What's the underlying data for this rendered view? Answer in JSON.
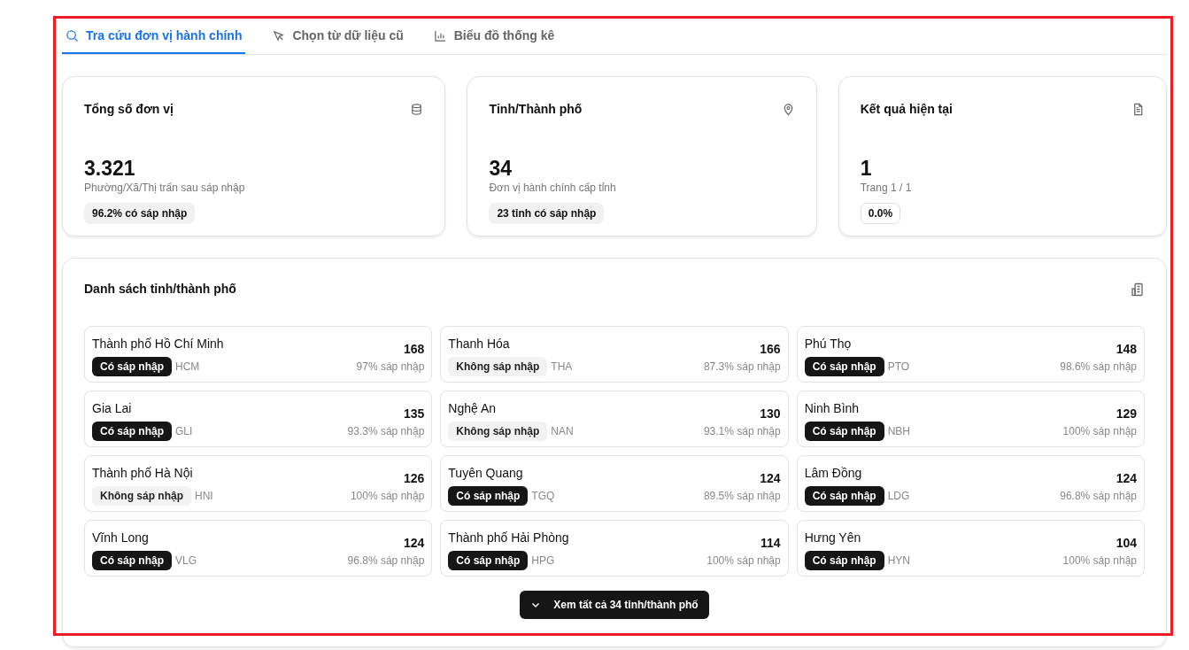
{
  "tabs": [
    {
      "label": "Tra cứu đơn vị hành chính",
      "selected": true
    },
    {
      "label": "Chọn từ dữ liệu cũ",
      "selected": false
    },
    {
      "label": "Biểu đồ thống kê",
      "selected": false
    }
  ],
  "stats": [
    {
      "title": "Tổng số đơn vị",
      "value": "3.321",
      "subtitle": "Phường/Xã/Thị trấn sau sáp nhập",
      "badge": "96.2% có sáp nhập",
      "outlined": false
    },
    {
      "title": "Tỉnh/Thành phố",
      "value": "34",
      "subtitle": "Đơn vị hành chính cấp tỉnh",
      "badge": "23 tỉnh có sáp nhập",
      "outlined": false
    },
    {
      "title": "Kết quả hiện tại",
      "value": "1",
      "subtitle": "Trang 1 / 1",
      "badge": "0.0%",
      "outlined": true
    }
  ],
  "province_list": {
    "title": "Danh sách tỉnh/thành phố",
    "items": [
      {
        "name": "Thành phố Hồ Chí Minh",
        "merged": true,
        "status": "Có sáp nhập",
        "code": "HCM",
        "count": "168",
        "rate": "97% sáp nhập"
      },
      {
        "name": "Thanh Hóa",
        "merged": false,
        "status": "Không sáp nhập",
        "code": "THA",
        "count": "166",
        "rate": "87.3% sáp nhập"
      },
      {
        "name": "Phú Thọ",
        "merged": true,
        "status": "Có sáp nhập",
        "code": "PTO",
        "count": "148",
        "rate": "98.6% sáp nhập"
      },
      {
        "name": "Gia Lai",
        "merged": true,
        "status": "Có sáp nhập",
        "code": "GLI",
        "count": "135",
        "rate": "93.3% sáp nhập"
      },
      {
        "name": "Nghệ An",
        "merged": false,
        "status": "Không sáp nhập",
        "code": "NAN",
        "count": "130",
        "rate": "93.1% sáp nhập"
      },
      {
        "name": "Ninh Bình",
        "merged": true,
        "status": "Có sáp nhập",
        "code": "NBH",
        "count": "129",
        "rate": "100% sáp nhập"
      },
      {
        "name": "Thành phố Hà Nội",
        "merged": false,
        "status": "Không sáp nhập",
        "code": "HNI",
        "count": "126",
        "rate": "100% sáp nhập"
      },
      {
        "name": "Tuyên Quang",
        "merged": true,
        "status": "Có sáp nhập",
        "code": "TGQ",
        "count": "124",
        "rate": "89.5% sáp nhập"
      },
      {
        "name": "Lâm Đồng",
        "merged": true,
        "status": "Có sáp nhập",
        "code": "LDG",
        "count": "124",
        "rate": "96.8% sáp nhập"
      },
      {
        "name": "Vĩnh Long",
        "merged": true,
        "status": "Có sáp nhập",
        "code": "VLG",
        "count": "124",
        "rate": "96.8% sáp nhập"
      },
      {
        "name": "Thành phố Hải Phòng",
        "merged": true,
        "status": "Có sáp nhập",
        "code": "HPG",
        "count": "114",
        "rate": "100% sáp nhập"
      },
      {
        "name": "Hưng Yên",
        "merged": true,
        "status": "Có sáp nhập",
        "code": "HYN",
        "count": "104",
        "rate": "100% sáp nhập"
      }
    ],
    "show_all_button": "Xem tất cả 34 tỉnh/thành phố"
  }
}
